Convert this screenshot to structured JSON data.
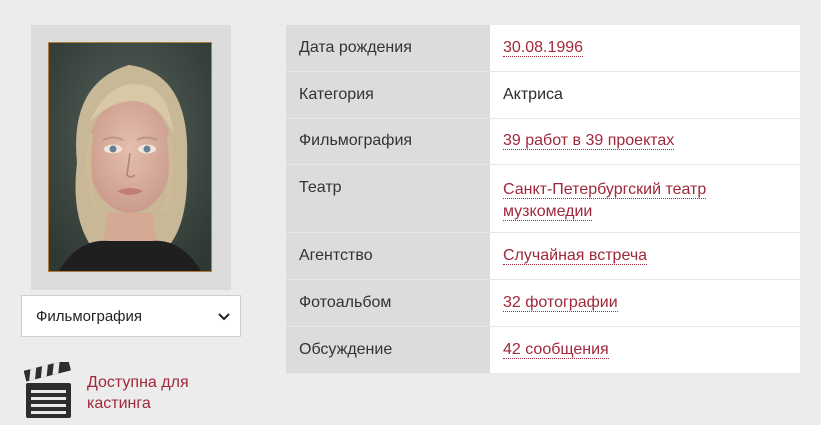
{
  "filmography_select": {
    "selected": "Фильмография"
  },
  "casting": {
    "text": "Доступна для кастинга"
  },
  "info_rows": [
    {
      "label": "Дата рождения",
      "value": "30.08.1996",
      "link": true
    },
    {
      "label": "Категория",
      "value": "Актриса",
      "link": false
    },
    {
      "label": "Фильмография",
      "value": "39 работ в 39 проектах",
      "link": true
    },
    {
      "label": "Театр",
      "value": "Санкт-Петербургский театр музкомедии",
      "link": true
    },
    {
      "label": "Агентство",
      "value": "Случайная встреча",
      "link": true
    },
    {
      "label": "Фотоальбом",
      "value": "32 фотографии",
      "link": true
    },
    {
      "label": "Обсуждение",
      "value": "42 сообщения",
      "link": true
    }
  ],
  "colors": {
    "link": "#a0283a",
    "label_bg": "#dcdcdc",
    "page_bg": "#ececec"
  },
  "icons": {
    "casting": "clapperboard-icon",
    "select": "chevron-down-icon"
  }
}
